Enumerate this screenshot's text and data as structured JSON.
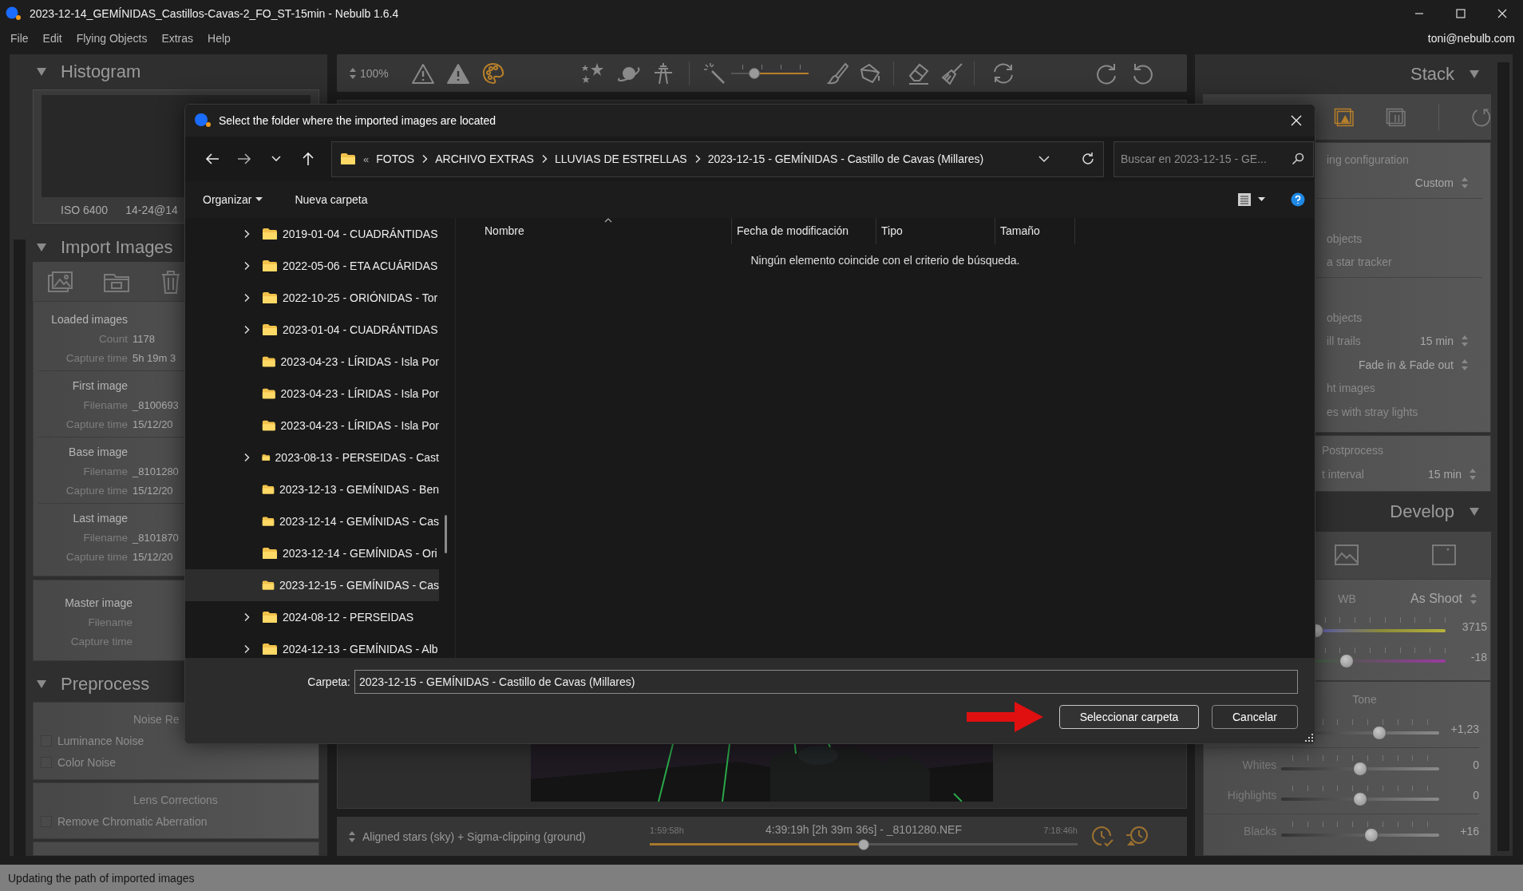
{
  "window": {
    "title": "2023-12-14_GEMÍNIDAS_Castillos-Cavas-2_FO_ST-15min - Nebulb 1.6.4"
  },
  "menu": [
    "File",
    "Edit",
    "Flying Objects",
    "Extras",
    "Help"
  ],
  "account": "toni@nebulb.com",
  "left_panel": {
    "histogram": {
      "title": "Histogram",
      "expanded": true,
      "iso": "ISO 6400",
      "lens": "14-24@14"
    },
    "import_images": {
      "title": "Import Images",
      "expanded": true,
      "groups": [
        {
          "heading": "Loaded images",
          "fields": [
            {
              "label": "Count",
              "value": "1178"
            },
            {
              "label": "Capture time",
              "value": "5h 19m 3"
            }
          ]
        },
        {
          "heading": "First image",
          "fields": [
            {
              "label": "Filename",
              "value": "_8100693"
            },
            {
              "label": "Capture time",
              "value": "15/12/20"
            }
          ]
        },
        {
          "heading": "Base image",
          "fields": [
            {
              "label": "Filename",
              "value": "_8101280"
            },
            {
              "label": "Capture time",
              "value": "15/12/20"
            }
          ]
        },
        {
          "heading": "Last image",
          "fields": [
            {
              "label": "Filename",
              "value": "_8101870"
            },
            {
              "label": "Capture time",
              "value": "15/12/20"
            }
          ]
        }
      ],
      "master": {
        "heading": "Master image",
        "fields": [
          {
            "label": "Filename"
          },
          {
            "label": "Capture time"
          }
        ]
      }
    },
    "preprocess": {
      "title": "Preprocess",
      "expanded": true,
      "sections": [
        {
          "heading": "Noise Re",
          "options": [
            {
              "label": "Luminance Noise",
              "checked": false
            },
            {
              "label": "Color Noise",
              "checked": false
            }
          ]
        },
        {
          "heading": "Lens Corrections",
          "options": [
            {
              "label": "Remove Chromatic Aberration",
              "checked": false
            }
          ]
        }
      ]
    }
  },
  "toolbar": {
    "zoom": "100%",
    "brush_size": {
      "level": 0.3
    }
  },
  "bottom_bar": {
    "blend_mode": "Aligned stars (sky) + Sigma-clipping (ground)",
    "start_time": "1:59:58h",
    "current": "4:39:19h [2h 39m 36s] - _8101280.NEF",
    "end_time": "7:18:46h",
    "timeline": {
      "level": 0.5
    }
  },
  "right_panel": {
    "stack": {
      "title": "Stack",
      "expanded": true,
      "groups": [
        {
          "rows": [
            {
              "label": "ing configuration"
            },
            {
              "value": "Custom"
            }
          ]
        },
        {
          "rows": [
            {
              "label": "objects"
            },
            {
              "label": "a star tracker"
            }
          ]
        },
        {
          "rows": [
            {
              "label": "objects"
            },
            {
              "label": "ill trails",
              "value": "15 min"
            },
            {
              "value": "Fade in & Fade out"
            },
            {
              "label": "ht images"
            },
            {
              "label": "es with stray lights"
            }
          ]
        }
      ],
      "postprocess": [
        {
          "label": "Postprocess"
        },
        {
          "label": "t interval",
          "value": "15 min"
        }
      ]
    },
    "develop": {
      "title": "Develop",
      "expanded": true,
      "white_balance": {
        "label": "WB",
        "value": "As Shoot",
        "sliders": [
          {
            "kind": "temperature",
            "value": "3715",
            "level": 0.2
          },
          {
            "kind": "tint",
            "value": "-18",
            "level": 0.39
          }
        ]
      },
      "tone": {
        "heading": "Tone",
        "groups": [
          {
            "sliders": [
              {
                "kind": "plain",
                "value": "+1,23",
                "level": 0.62
              }
            ]
          },
          {
            "sliders": [
              {
                "kind": "plain",
                "label": "Whites",
                "value": "0",
                "level": 0.5
              },
              {
                "kind": "plain",
                "label": "Highlights",
                "value": "0",
                "level": 0.5
              }
            ]
          },
          {
            "sliders": [
              {
                "kind": "plain",
                "label": "Blacks",
                "value": "+16",
                "level": 0.57
              }
            ]
          }
        ]
      }
    }
  },
  "dialog": {
    "title": "Select the folder where the imported images are located",
    "overflow": "«",
    "breadcrumb": [
      "FOTOS",
      "ARCHIVO EXTRAS",
      "LLUVIAS DE ESTRELLAS",
      "2023-12-15 - GEMÍNIDAS - Castillo de Cavas (Millares)"
    ],
    "search": {
      "placeholder": "Buscar en 2023-12-15 - GE..."
    },
    "organize": "Organizar",
    "new_folder": "Nueva carpeta",
    "folders": [
      {
        "name": "2019-01-04 - CUADRÁNTIDAS",
        "expandable": true,
        "selected": false
      },
      {
        "name": "2022-05-06 - ETA ACUÁRIDAS",
        "expandable": true,
        "selected": false
      },
      {
        "name": "2022-10-25 - ORIÓNIDAS - Tor",
        "expandable": true,
        "selected": false
      },
      {
        "name": "2023-01-04 - CUADRÁNTIDAS",
        "expandable": true,
        "selected": false
      },
      {
        "name": "2023-04-23 - LÍRIDAS - Isla Por",
        "expandable": false,
        "selected": false
      },
      {
        "name": "2023-04-23 - LÍRIDAS - Isla Por",
        "expandable": false,
        "selected": false
      },
      {
        "name": "2023-04-23 - LÍRIDAS - Isla Por",
        "expandable": false,
        "selected": false
      },
      {
        "name": "2023-08-13 - PERSEIDAS - Cast",
        "expandable": true,
        "selected": false
      },
      {
        "name": "2023-12-13 - GEMÍNIDAS - Ben",
        "expandable": false,
        "selected": false
      },
      {
        "name": "2023-12-14 - GEMÍNIDAS - Cas",
        "expandable": false,
        "selected": false
      },
      {
        "name": "2023-12-14 - GEMÍNIDAS - Ori",
        "expandable": false,
        "selected": false
      },
      {
        "name": "2023-12-15 - GEMÍNIDAS - Cas",
        "expandable": false,
        "selected": true
      },
      {
        "name": "2024-08-12 - PERSEIDAS",
        "expandable": true,
        "selected": false
      },
      {
        "name": "2024-12-13 - GEMÍNIDAS - Alb",
        "expandable": true,
        "selected": false
      }
    ],
    "columns": [
      "Nombre",
      "Fecha de modificación",
      "Tipo",
      "Tamaño"
    ],
    "empty_message": "Ningún elemento coincide con el criterio de búsqueda.",
    "folder_label": "Carpeta:",
    "folder_value": "2023-12-15 - GEMÍNIDAS - Castillo de Cavas (Millares)",
    "buttons": [
      {
        "label": "Seleccionar carpeta",
        "primary": true
      },
      {
        "label": "Cancelar",
        "primary": false
      }
    ]
  },
  "status_bar": "Updating the path of imported images"
}
